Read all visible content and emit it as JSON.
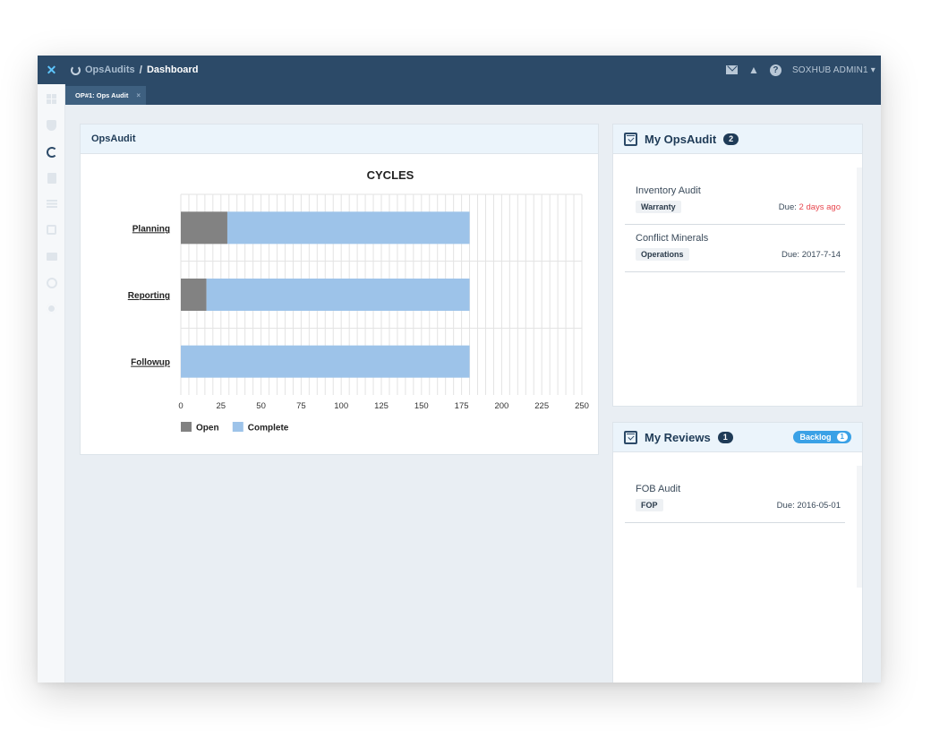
{
  "header": {
    "logo_glyph": "✕",
    "app_name": "OpsAudits",
    "separator": "/",
    "page": "Dashboard",
    "icons": [
      "mail-icon",
      "bell-icon",
      "help-icon"
    ],
    "help_glyph": "?",
    "user": "SOXHUB ADMIN1",
    "user_caret": "▾"
  },
  "tabs": [
    {
      "label": "OP#1: Ops Audit",
      "close": "×"
    }
  ],
  "sidebar": {
    "items": [
      "dashboard-icon",
      "shield-icon",
      "ops-ring-icon",
      "document-icon",
      "list-icon",
      "calendar-icon",
      "folder-icon",
      "clock-icon",
      "gear-icon"
    ],
    "active": "ops-ring-icon"
  },
  "ops_panel": {
    "title": "OpsAudit"
  },
  "chart_data": {
    "type": "bar",
    "orientation": "horizontal",
    "stacked": true,
    "title": "CYCLES",
    "categories": [
      "Planning",
      "Reporting",
      "Followup"
    ],
    "series": [
      {
        "name": "Open",
        "values": [
          29,
          16,
          0
        ],
        "color": "#828282"
      },
      {
        "name": "Complete",
        "values": [
          151,
          164,
          180
        ],
        "color": "#9dc3e9"
      }
    ],
    "xlim": [
      0,
      250
    ],
    "x_ticks": [
      0,
      25,
      50,
      75,
      100,
      125,
      150,
      175,
      200,
      225,
      250
    ],
    "grid": true,
    "legend_position": "bottom-left"
  },
  "my_opsaudit": {
    "title": "My OpsAudit",
    "count": "2",
    "items": [
      {
        "title": "Inventory Audit",
        "tag": "Warranty",
        "due_label": "Due:",
        "due_value": "2 days ago",
        "overdue": true
      },
      {
        "title": "Conflict Minerals",
        "tag": "Operations",
        "due_label": "Due:",
        "due_value": "2017-7-14",
        "overdue": false
      }
    ]
  },
  "my_reviews": {
    "title": "My Reviews",
    "count": "1",
    "backlog_label": "Backlog",
    "backlog_count": "1",
    "items": [
      {
        "title": "FOB Audit",
        "tag": "FOP",
        "due_label": "Due:",
        "due_value": "2016-05-01",
        "overdue": false
      }
    ]
  },
  "colors": {
    "navbar": "#2c4a68",
    "accent": "#3aa1e6",
    "overdue": "#e8474f"
  }
}
